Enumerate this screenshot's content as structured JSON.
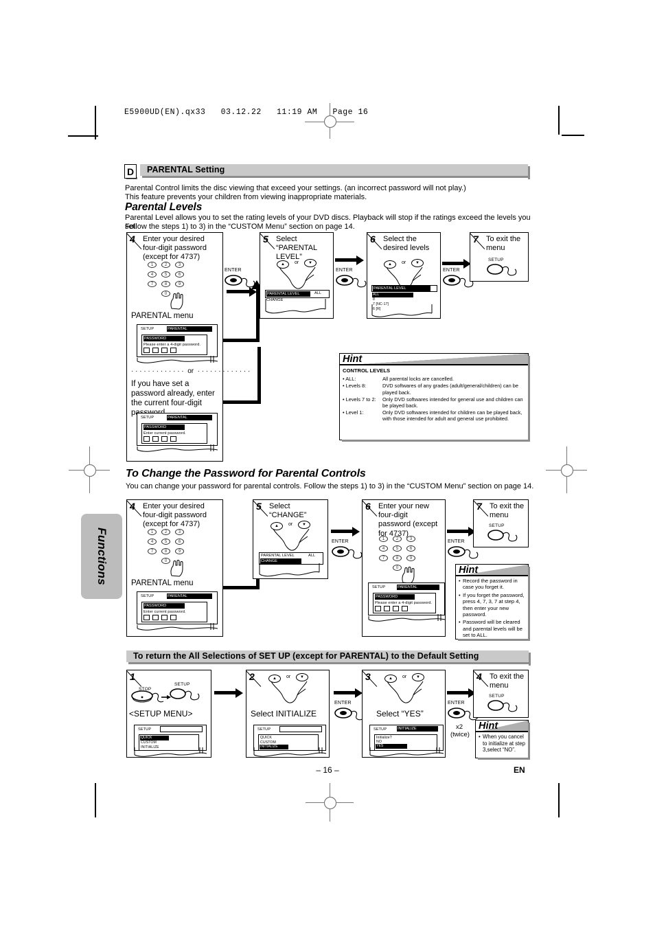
{
  "print_header": "E5900UD(EN).qx33   03.12.22   11:19 AM   Page 16",
  "side_tab": "Functions",
  "footer": {
    "page": "– 16 –",
    "lang": "EN"
  },
  "section_d": {
    "marker": "D",
    "title": "PARENTAL Setting",
    "intro_line1": "Parental Control limits the disc viewing that exceed your settings. (an incorrect password will not play.)",
    "intro_line2": "This feature prevents your children from viewing inappropriate materials.",
    "subtitle": "Parental Levels",
    "desc_line1": "Parental Level allows you to set the rating levels of your DVD discs. Playback will stop if the ratings exceed the levels you set.",
    "desc_line2": "Follow the steps 1) to 3) in the “CUSTOM Menu” section on page 14."
  },
  "levels_steps": {
    "s4": {
      "num": "4",
      "text": "Enter your desired four-digit password (except for 4737)",
      "keypad": [
        "1",
        "2",
        "3",
        "4",
        "5",
        "6",
        "7",
        "8",
        "9",
        "0"
      ],
      "menu_label": "PARENTAL menu",
      "osd_a": {
        "setup": "SETUP",
        "tab": "PARENTAL",
        "field": "PASSWORD",
        "prompt": "Please enter a 4-digit password.",
        "boxes": 4
      },
      "or": "or",
      "alt_text": "If you have set a password already, enter the current four-digit password.",
      "osd_b": {
        "setup": "SETUP",
        "tab": "PARENTAL",
        "field": "PASSWORD",
        "prompt": "Enter current password.",
        "boxes": 4
      }
    },
    "s5": {
      "num": "5",
      "text": "Select “PARENTAL LEVEL”",
      "or": "or",
      "osd": {
        "row1_label": "PARENTAL LEVEL",
        "row1_value": "ALL",
        "row2_label": "CHANGE"
      }
    },
    "s6": {
      "num": "6",
      "text": "Select the desired levels",
      "or": "or",
      "osd": {
        "title": "PARENTAL LEVEL",
        "items": [
          "ALL",
          "8",
          "7 [NC-17]",
          "6 [R]"
        ]
      }
    },
    "s7": {
      "num": "7",
      "text": "To exit the menu",
      "button": "SETUP"
    },
    "enter_label": "ENTER"
  },
  "hint_levels": {
    "word": "Hint",
    "heading": "CONTROL LEVELS",
    "rows": [
      {
        "key": "• ALL:",
        "value": "All parental locks are cancelled."
      },
      {
        "key": "• Levels 8:",
        "value": "DVD softwares of any grades (adult/general/children) can be played back."
      },
      {
        "key": "• Levels 7 to 2:",
        "value": "Only DVD softwares intended for general use and children can be played back."
      },
      {
        "key": "• Level 1:",
        "value": "Only DVD softwares intended for children can be played back, with those intended for adult and general use prohibited."
      }
    ]
  },
  "change_pw": {
    "title": "To Change the Password for Parental Controls",
    "desc": "You can change your password for parental controls.  Follow the steps 1) to 3) in the “CUSTOM Menu” section on page 14.",
    "s4": {
      "num": "4",
      "text": "Enter your desired four-digit password (except for 4737)",
      "keypad": [
        "1",
        "2",
        "3",
        "4",
        "5",
        "6",
        "7",
        "8",
        "9",
        "0"
      ],
      "menu_label": "PARENTAL menu",
      "osd": {
        "setup": "SETUP",
        "tab": "PARENTAL",
        "field": "PASSWORD",
        "prompt": "Enter current password.",
        "boxes": 4
      }
    },
    "s5": {
      "num": "5",
      "text": "Select “CHANGE”",
      "or": "or",
      "osd": {
        "row1_label": "PARENTAL LEVEL",
        "row1_value": "ALL",
        "row2_label": "CHANGE"
      }
    },
    "s6": {
      "num": "6",
      "text": "Enter your new four-digit password (except for 4737)",
      "keypad": [
        "1",
        "2",
        "3",
        "4",
        "5",
        "6",
        "7",
        "8",
        "9",
        "0"
      ],
      "osd": {
        "setup": "SETUP",
        "tab": "PARENTAL",
        "field": "PASSWORD",
        "prompt": "Please enter a 4-digit password.",
        "boxes": 4
      }
    },
    "s7": {
      "num": "7",
      "text": "To exit the menu",
      "button": "SETUP"
    },
    "enter_label": "ENTER"
  },
  "hint_password": {
    "word": "Hint",
    "items": [
      "Record the password in case you forget it.",
      "If you forget the password, press 4, 7, 3, 7 at step 4, then enter your new password.",
      "Password will be cleared and parental levels will be set to ALL."
    ]
  },
  "initialize": {
    "title": "To return the All Selections of SET UP (except for PARENTAL) to the Default Setting",
    "s1": {
      "num": "1",
      "stop_btn": "STOP",
      "setup_btn": "SETUP",
      "caption": "<SETUP MENU>",
      "osd": {
        "setup": "SETUP",
        "items": [
          "QUICK",
          "CUSTOM",
          "INITIALIZE"
        ],
        "selected": "QUICK"
      }
    },
    "s2": {
      "num": "2",
      "or": "or",
      "caption": "Select INITIALIZE",
      "osd": {
        "setup": "SETUP",
        "items": [
          "QUICK",
          "CUSTOM",
          "INITIALIZE"
        ],
        "selected": "INITIALIZE"
      }
    },
    "s3": {
      "num": "3",
      "or": "or",
      "caption": "Select “YES”",
      "osd": {
        "setup": "SETUP",
        "tab": "INITIALIZE",
        "prompt": "Initialize?",
        "items": [
          "NO",
          "YES"
        ],
        "selected": "YES"
      }
    },
    "s4": {
      "num": "4",
      "text": "To exit the menu",
      "button": "SETUP"
    },
    "enter_label": "ENTER",
    "repeat_line1": "x2",
    "repeat_line2": "(twice)"
  },
  "hint_initialize": {
    "word": "Hint",
    "items": [
      "When you cancel to initialize at step 3,select “NO”."
    ]
  }
}
